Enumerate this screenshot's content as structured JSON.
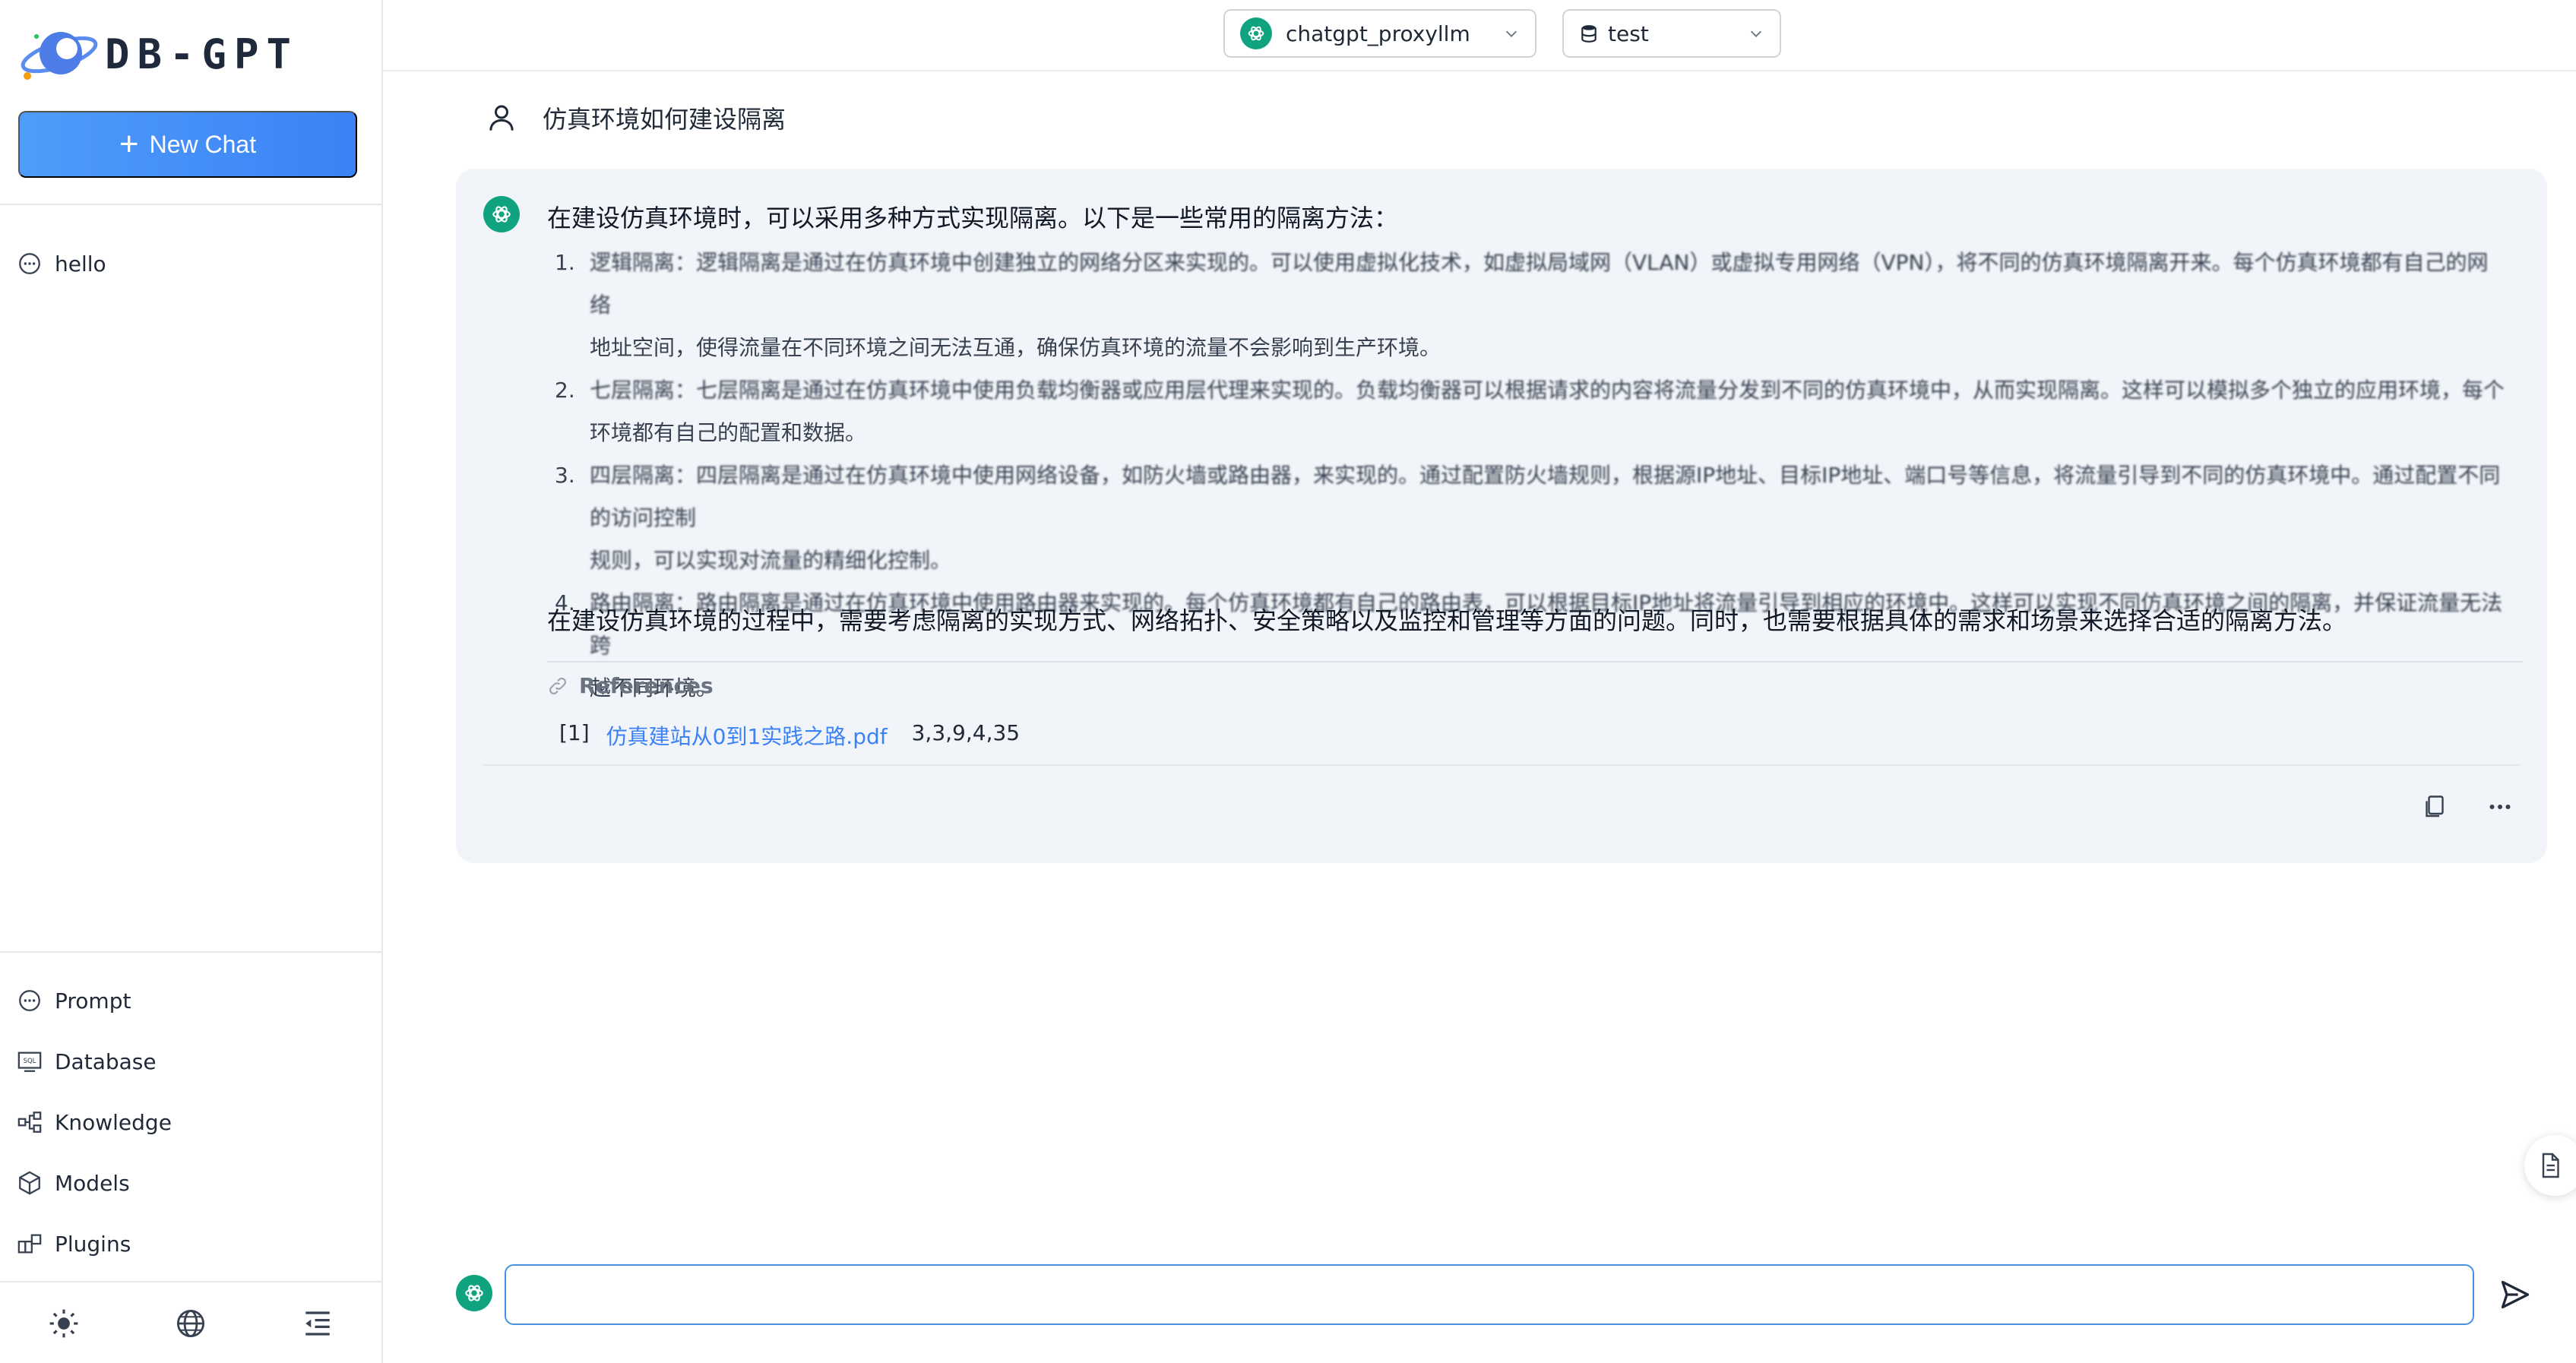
{
  "app": {
    "brand": "DB-GPT"
  },
  "sidebar": {
    "new_chat_label": "New Chat",
    "history": [
      {
        "label": "hello"
      }
    ],
    "nav": [
      {
        "label": "Prompt",
        "icon": "message-icon"
      },
      {
        "label": "Database",
        "icon": "sql-icon"
      },
      {
        "label": "Knowledge",
        "icon": "knowledge-graph-icon"
      },
      {
        "label": "Models",
        "icon": "cube-icon"
      },
      {
        "label": "Plugins",
        "icon": "plugin-icon"
      }
    ],
    "bottom_icons": [
      "sun-icon",
      "globe-icon",
      "collapse-menu-icon"
    ]
  },
  "header": {
    "model_select": "chatgpt_proxyllm",
    "db_select": "test"
  },
  "conversation": {
    "question": "仿真环境如何建设隔离",
    "answer": {
      "intro": "在建设仿真环境时，可以采用多种方式实现隔离。以下是一些常用的隔离方法：",
      "items": [
        {
          "num": "1.",
          "line1": "逻辑隔离：逻辑隔离是通过在仿真环境中创建独立的网络分区来实现的。可以使用虚拟化技术，如虚拟局域网（VLAN）或虚拟专用网络（VPN），将不同的仿真环境隔离开来。每个仿真环境都有自己的网络",
          "line2": "地址空间，使得流量在不同环境之间无法互通，确保仿真环境的流量不会影响到生产环境。"
        },
        {
          "num": "2.",
          "line1": "七层隔离：七层隔离是通过在仿真环境中使用负载均衡器或应用层代理来实现的。负载均衡器可以根据请求的内容将流量分发到不同的仿真环境中，从而实现隔离。这样可以模拟多个独立的应用环境，每个",
          "line2": "环境都有自己的配置和数据。"
        },
        {
          "num": "3.",
          "line1": "四层隔离：四层隔离是通过在仿真环境中使用网络设备，如防火墙或路由器，来实现的。通过配置防火墙规则，根据源IP地址、目标IP地址、端口号等信息，将流量引导到不同的仿真环境中。通过配置不同的访问控制",
          "line2": "规则，可以实现对流量的精细化控制。"
        },
        {
          "num": "4.",
          "line1": "路由隔离：路由隔离是通过在仿真环境中使用路由器来实现的。每个仿真环境都有自己的路由表，可以根据目标IP地址将流量引导到相应的环境中。这样可以实现不同仿真环境之间的隔离，并保证流量无法跨",
          "line2": "越不同环境。"
        }
      ],
      "outro": "在建设仿真环境的过程中，需要考虑隔离的实现方式、网络拓扑、安全策略以及监控和管理等方面的问题。同时，也需要根据具体的需求和场景来选择合适的隔离方法。"
    },
    "references": {
      "title": "References",
      "items": [
        {
          "index": "[1]",
          "file": "仿真建站从0到1实践之路.pdf",
          "pages": "3,3,9,4,35"
        }
      ]
    }
  },
  "input": {
    "placeholder": "",
    "value": ""
  }
}
